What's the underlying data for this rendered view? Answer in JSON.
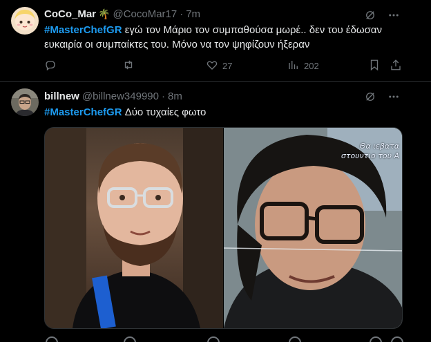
{
  "tweets": [
    {
      "name": "CoCo_Mar",
      "emoji": "🌴",
      "handle": "@CocoMar17",
      "separator": "·",
      "time": "7m",
      "hashtag": "#MasterChefGR",
      "text": " εγώ τον Μάριο τον συμπαθούσα μωρέ.. δεν του έδωσαν ευκαιρία οι συμπαίκτες του. Μόνο να τον ψηφίζουν ήξεραν",
      "actions": {
        "reply": "",
        "retweet": "",
        "likes": "27",
        "views": "202"
      }
    },
    {
      "name": "billnew",
      "handle": "@billnew349990",
      "separator": "·",
      "time": "8m",
      "hashtag": "#MasterChefGR",
      "text": " Δύο τυχαίες φωτο",
      "media_caption_line1": "Θα ιεβατα",
      "media_caption_line2": "στουντιο του Α"
    }
  ],
  "icons": {
    "grok": "grok-icon",
    "more": "more-icon",
    "reply": "reply-icon",
    "retweet": "retweet-icon",
    "like": "like-icon",
    "views": "views-icon",
    "bookmark": "bookmark-icon",
    "share": "share-icon"
  },
  "colors": {
    "background": "#000000",
    "text": "#e7e9ea",
    "muted": "#71767b",
    "accent": "#1d9bf0",
    "border": "#2f3336"
  }
}
